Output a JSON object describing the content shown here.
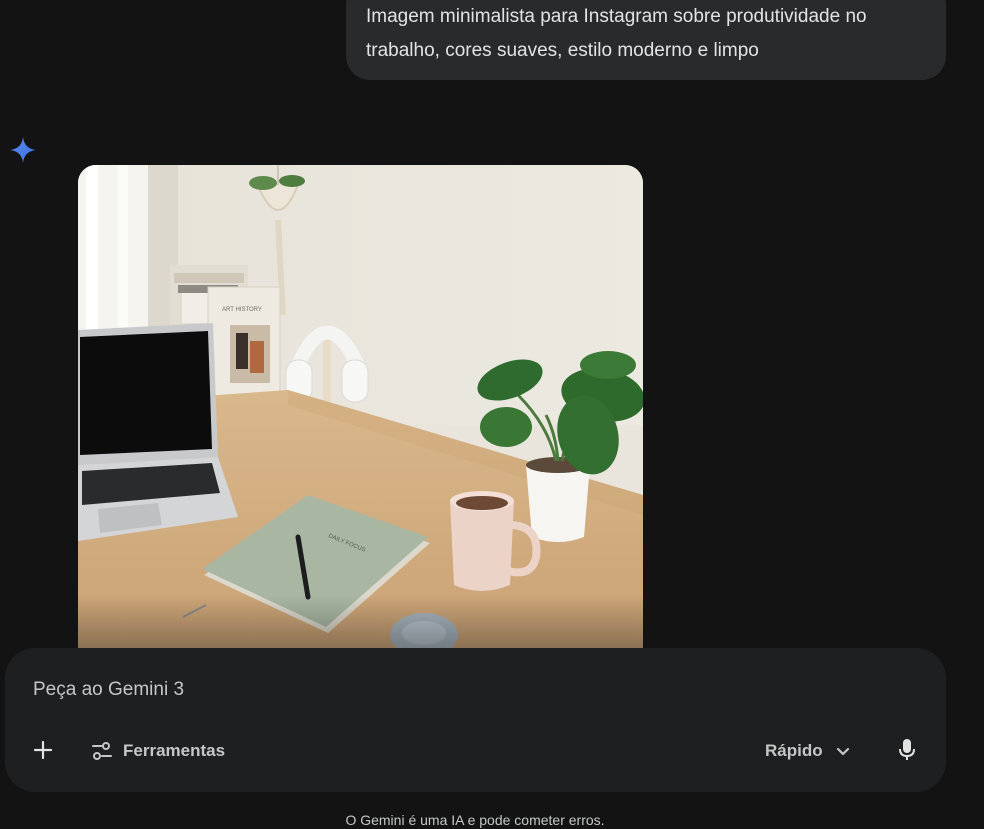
{
  "user_message": {
    "text": "Imagem minimalista para Instagram sobre produtividade no trabalho, cores suaves, estilo moderno e limpo"
  },
  "assistant": {
    "icon": "gemini-sparkle-icon",
    "generated_image": {
      "book_cover_text": "DAILY FOCUS",
      "shelf_book_text": "ART HISTORY"
    }
  },
  "composer": {
    "placeholder": "Peça ao Gemini 3",
    "tools_label": "Ferramentas",
    "mode_label": "Rápido",
    "icons": {
      "add": "plus-icon",
      "tools": "sliders-icon",
      "mode": "chevron-down-icon",
      "mic": "microphone-icon"
    }
  },
  "disclaimer": "O Gemini é uma IA e pode cometer erros.",
  "colors": {
    "background": "#131314",
    "bubble": "#282a2c",
    "composer": "#1e1f20",
    "accent": "#4285f4",
    "text": "#e3e3e3"
  }
}
